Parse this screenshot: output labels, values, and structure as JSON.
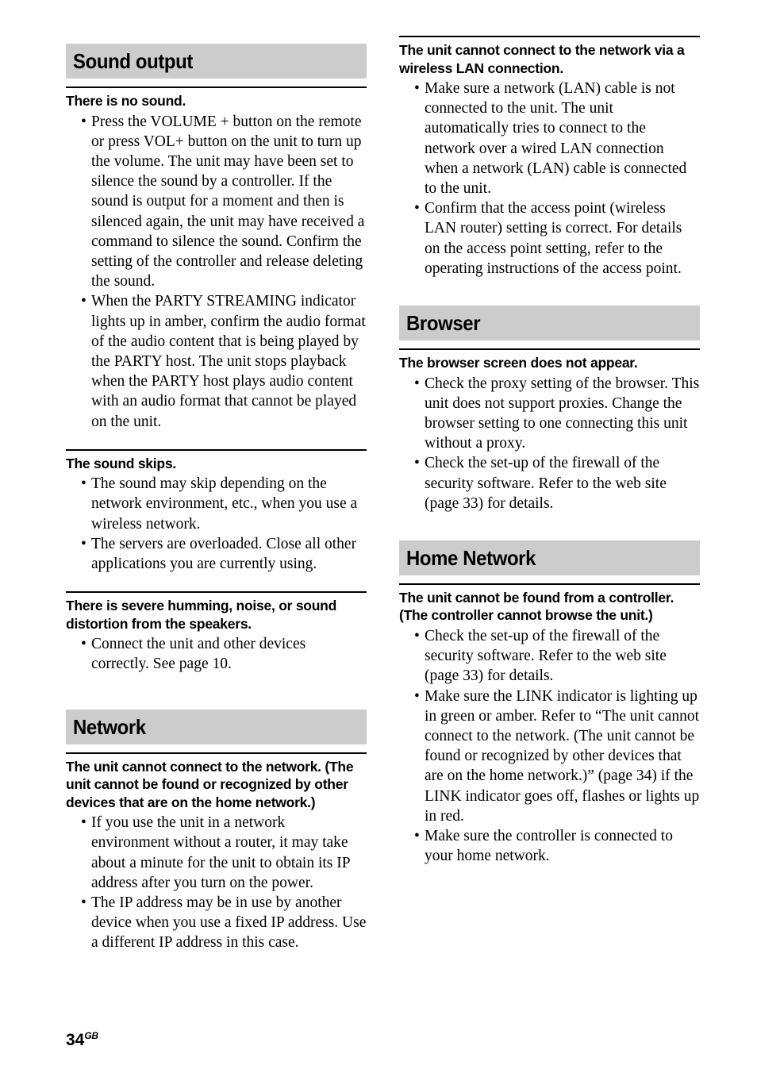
{
  "page": {
    "number": "34",
    "number_suffix": "GB"
  },
  "left_column": {
    "sections": [
      {
        "banner": "Sound output",
        "topics": [
          {
            "heading": "There is no sound.",
            "bullets": [
              "Press the VOLUME + button on the remote or press VOL+ button on the unit to turn up the volume. The unit may have been set to silence the sound by a controller. If the sound is output for a moment and then is silenced again, the unit may have received a command to silence the sound. Confirm the setting of the controller and release deleting the sound.",
              "When the PARTY STREAMING indicator lights up in amber, confirm the audio format of the audio content that is being played by the PARTY host. The unit stops playback when the PARTY host plays audio content with an audio format that cannot be played on the unit."
            ]
          },
          {
            "heading": "The sound skips.",
            "bullets": [
              "The sound may skip depending on the network environment, etc., when you use a wireless network.",
              "The servers are overloaded. Close all other applications you are currently using."
            ]
          },
          {
            "heading": "There is severe humming, noise, or sound distortion from the speakers.",
            "bullets": [
              "Connect the unit and other devices correctly. See page 10."
            ]
          }
        ]
      },
      {
        "banner": "Network",
        "topics": [
          {
            "heading": "The unit cannot connect to the network. (The unit cannot be found or recognized by other devices that are on the home network.)",
            "bullets": [
              "If you use the unit in a network environment without a router, it may take about a minute for the unit to obtain its IP address after you turn on the power.",
              "The IP address may be in use by another device when you use a fixed IP address. Use a different IP address in this case."
            ]
          }
        ]
      }
    ]
  },
  "right_column": {
    "continued_topic": {
      "heading": "The unit cannot connect to the network via a wireless LAN connection.",
      "bullets": [
        "Make sure a network (LAN) cable is not connected to the unit. The unit automatically tries to connect to the network over a wired LAN connection when a network (LAN) cable is connected to the unit.",
        "Confirm that the access point (wireless LAN router) setting is correct. For details on the access point setting, refer to the operating instructions of the access point."
      ]
    },
    "sections": [
      {
        "banner": "Browser",
        "topics": [
          {
            "heading": "The browser screen does not appear.",
            "bullets": [
              "Check the proxy setting of the browser. This unit does not support proxies. Change the browser setting to one connecting this unit without a proxy.",
              "Check the set-up of the firewall of the security software. Refer to the web site (page 33) for details."
            ]
          }
        ]
      },
      {
        "banner": "Home Network",
        "topics": [
          {
            "heading": "The unit cannot be found from a controller. (The controller cannot browse the unit.)",
            "bullets": [
              "Check the set-up of the firewall of the security software. Refer to the web site (page 33) for details.",
              "Make sure the LINK indicator is lighting up in green or amber. Refer to “The unit cannot connect to the network. (The unit cannot be found or recognized by other devices that are on the home network.)” (page 34) if the LINK indicator goes off, flashes or lights up in red.",
              "Make sure the controller is connected to your home network."
            ]
          }
        ]
      }
    ]
  }
}
